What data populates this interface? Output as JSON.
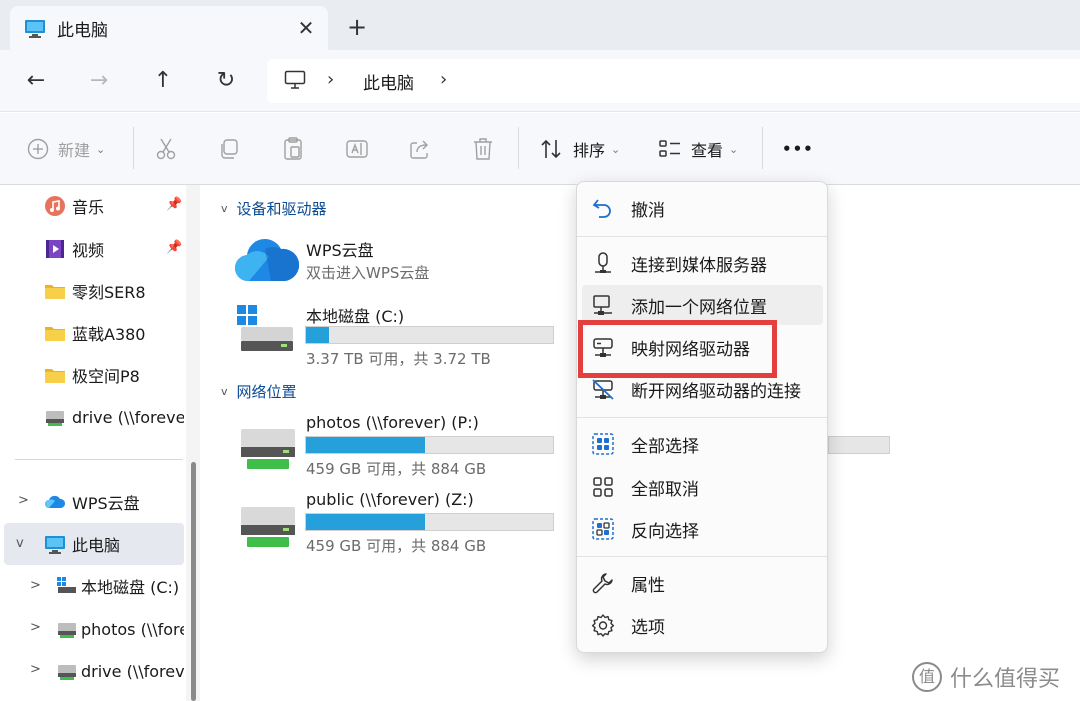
{
  "tab": {
    "title": "此电脑",
    "close": "✕",
    "new": "+"
  },
  "nav": {
    "back": "←",
    "forward": "→",
    "up": "↑",
    "refresh": "↻"
  },
  "address": {
    "chevron": "›",
    "location": "此电脑"
  },
  "toolbar": {
    "new_label": "新建",
    "sort_label": "排序",
    "view_label": "查看",
    "caret": "⌄",
    "more": "•••"
  },
  "sidebar": {
    "items": [
      {
        "label": "音乐",
        "icon": "music-icon",
        "pinned": true
      },
      {
        "label": "视频",
        "icon": "video-icon",
        "pinned": true
      },
      {
        "label": "零刻SER8",
        "icon": "folder-icon"
      },
      {
        "label": "蓝戟A380",
        "icon": "folder-icon"
      },
      {
        "label": "极空间P8",
        "icon": "folder-icon"
      },
      {
        "label": "drive (\\\\forever",
        "icon": "network-drive-icon"
      }
    ],
    "tree": [
      {
        "label": "WPS云盘",
        "icon": "cloud-icon",
        "expander": ">"
      },
      {
        "label": "此电脑",
        "icon": "pc-icon",
        "expander": "v"
      },
      {
        "label": "本地磁盘 (C:)",
        "icon": "windows-drive-icon",
        "expander": ">"
      },
      {
        "label": "photos (\\\\fore",
        "icon": "network-drive-icon",
        "expander": ">"
      },
      {
        "label": "drive (\\\\foreve",
        "icon": "network-drive-icon",
        "expander": ">"
      }
    ],
    "pin": "📌"
  },
  "main": {
    "groups": [
      {
        "label": "设备和驱动器",
        "chevron": "v"
      },
      {
        "label": "网络位置",
        "chevron": "v"
      }
    ],
    "drives": [
      {
        "name": "WPS云盘",
        "sub": "双击进入WPS云盘",
        "icon": "cloud-icon"
      },
      {
        "name": "本地磁盘 (C:)",
        "sub": "3.37 TB 可用，共 3.72 TB",
        "used_fraction": 0.094,
        "icon": "windows-drive-icon"
      },
      {
        "name": "photos (\\\\forever) (P:)",
        "sub": "459 GB 可用，共 884 GB",
        "used_fraction": 0.48,
        "icon": "network-drive-icon"
      },
      {
        "name": "public (\\\\forever) (Z:)",
        "sub": "459 GB 可用，共 884 GB",
        "used_fraction": 0.48,
        "icon": "network-drive-icon"
      }
    ]
  },
  "menu": {
    "items": [
      {
        "label": "撤消",
        "icon": "undo-icon"
      },
      {
        "label": "连接到媒体服务器",
        "icon": "media-server-icon"
      },
      {
        "label": "添加一个网络位置",
        "icon": "network-location-icon"
      },
      {
        "label": "映射网络驱动器",
        "icon": "map-drive-icon"
      },
      {
        "label": "断开网络驱动器的连接",
        "icon": "disconnect-drive-icon"
      },
      {
        "label": "全部选择",
        "icon": "select-all-icon"
      },
      {
        "label": "全部取消",
        "icon": "select-none-icon"
      },
      {
        "label": "反向选择",
        "icon": "invert-selection-icon"
      },
      {
        "label": "属性",
        "icon": "wrench-icon"
      },
      {
        "label": "选项",
        "icon": "settings-icon"
      }
    ]
  },
  "watermark": {
    "mark": "值",
    "text": "什么值得买"
  },
  "colors": {
    "accent": "#26a0da",
    "highlight": "#e33f3f",
    "group": "#0b4a94"
  }
}
